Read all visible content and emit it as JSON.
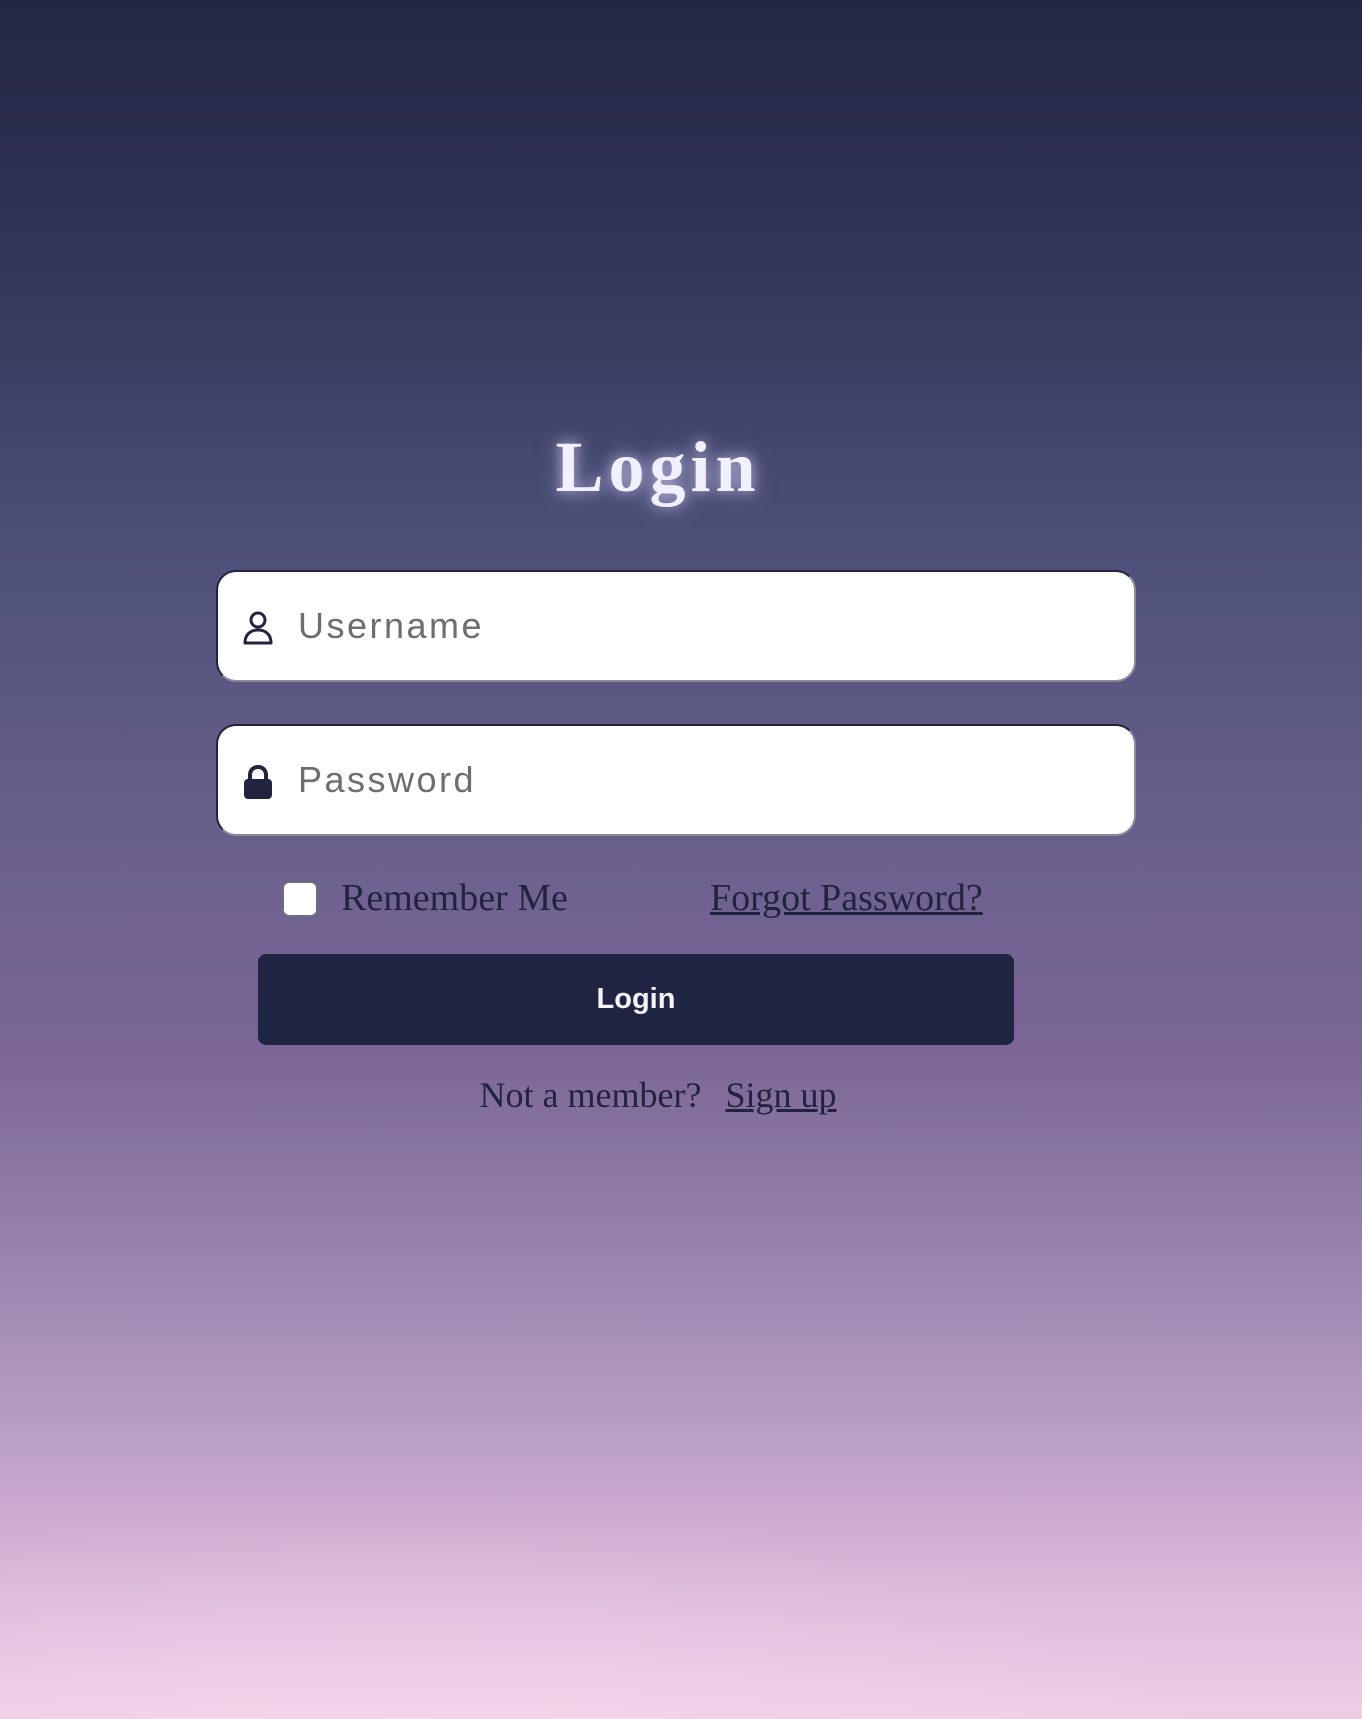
{
  "title": "Login",
  "username": {
    "placeholder": "Username",
    "value": "",
    "icon": "user-icon"
  },
  "password": {
    "placeholder": "Password",
    "value": "",
    "icon": "lock-icon"
  },
  "remember_me": {
    "label": "Remember Me",
    "checked": false
  },
  "forgot_password": "Forgot Password?",
  "login_button": "Login",
  "signup": {
    "prompt": "Not a member?",
    "link": "Sign up"
  },
  "colors": {
    "primary": "#212544",
    "field_bg": "#ffffff",
    "title_text": "#f1f0ff",
    "gradient_top": "#232644",
    "gradient_bottom": "#efcde6"
  }
}
